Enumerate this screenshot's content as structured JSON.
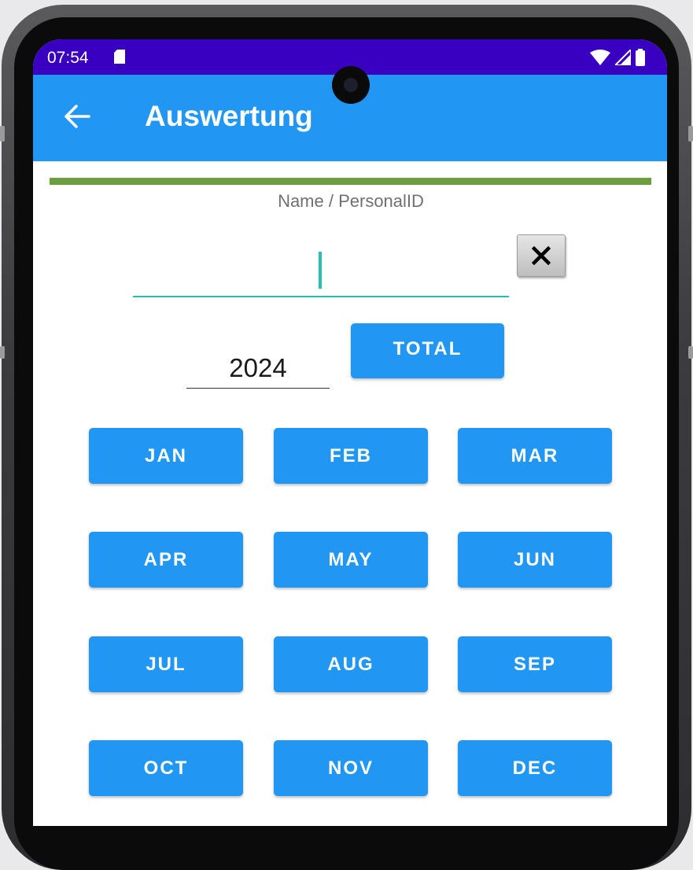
{
  "status_bar": {
    "time": "07:54",
    "icons": [
      "sd-card-icon",
      "wifi-icon",
      "signal-icon",
      "battery-icon"
    ]
  },
  "app_bar": {
    "title": "Auswertung",
    "back_icon": "arrow-left-icon"
  },
  "form": {
    "name_label": "Name / PersonalID",
    "name_value": "",
    "clear_symbol": "✕",
    "year_value": "2024",
    "total_label": "TOTAL"
  },
  "months": [
    "JAN",
    "FEB",
    "MAR",
    "APR",
    "MAY",
    "JUN",
    "JUL",
    "AUG",
    "SEP",
    "OCT",
    "NOV",
    "DEC"
  ],
  "colors": {
    "status_bar": "#3A00C2",
    "app_bar": "#2196F3",
    "button": "#2196F3",
    "divider": "#6A9E3F",
    "input_underline": "#26BFB5"
  }
}
